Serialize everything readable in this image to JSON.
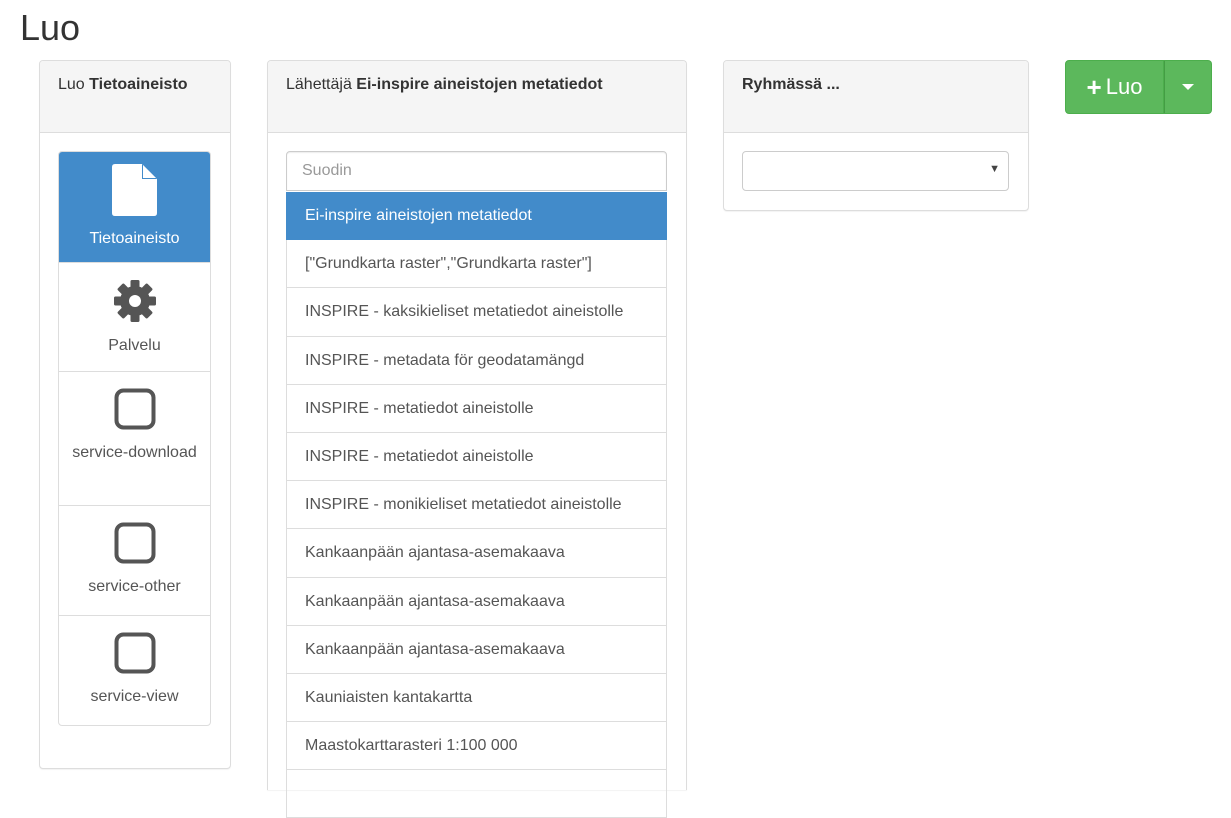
{
  "page": {
    "title": "Luo"
  },
  "type_panel": {
    "heading_prefix": "Luo",
    "heading_strong": "Tietoaineisto",
    "items": [
      {
        "label": "Tietoaineisto",
        "icon": "file-icon",
        "active": true
      },
      {
        "label": "Palvelu",
        "icon": "gear-icon",
        "active": false
      },
      {
        "label": "service-download",
        "icon": "square-icon",
        "active": false
      },
      {
        "label": "service-other",
        "icon": "square-icon",
        "active": false
      },
      {
        "label": "service-view",
        "icon": "square-icon",
        "active": false
      }
    ]
  },
  "template_panel": {
    "heading_prefix": "Lähettäjä",
    "heading_strong": "Ei-inspire aineistojen metatiedot",
    "filter_placeholder": "Suodin",
    "items": [
      {
        "label": "Ei-inspire aineistojen metatiedot",
        "active": true
      },
      {
        "label": "[\"Grundkarta raster\",\"Grundkarta raster\"]",
        "active": false
      },
      {
        "label": "INSPIRE - kaksikieliset metatiedot aineistolle",
        "active": false
      },
      {
        "label": "INSPIRE - metadata för geodatamängd",
        "active": false
      },
      {
        "label": "INSPIRE - metatiedot aineistolle",
        "active": false
      },
      {
        "label": "INSPIRE - metatiedot aineistolle",
        "active": false
      },
      {
        "label": "INSPIRE - monikieliset metatiedot aineistolle",
        "active": false
      },
      {
        "label": "Kankaanpään ajantasa-asemakaava",
        "active": false
      },
      {
        "label": "Kankaanpään ajantasa-asemakaava",
        "active": false
      },
      {
        "label": "Kankaanpään ajantasa-asemakaava",
        "active": false
      },
      {
        "label": "Kauniaisten kantakartta",
        "active": false
      },
      {
        "label": "Maastokarttarasteri 1:100 000",
        "active": false
      },
      {
        "label": "",
        "active": false
      }
    ]
  },
  "group_panel": {
    "heading": "Ryhmässä ...",
    "selected_value": ""
  },
  "create_button": {
    "icon": "plus-icon",
    "label": "Luo",
    "toggle_icon": "caret-down-icon"
  },
  "colors": {
    "primary_active": "#428bca",
    "success": "#5cb85c",
    "panel_heading_bg": "#f5f5f5",
    "border": "#dddddd"
  }
}
